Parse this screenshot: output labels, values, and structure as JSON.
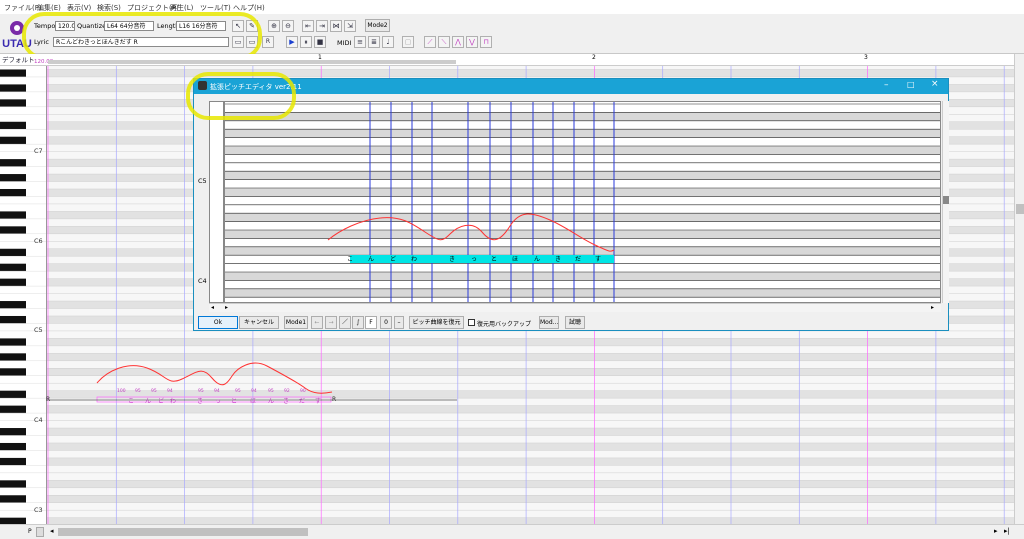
{
  "menu": [
    "ファイル(F)",
    "編集(E)",
    "表示(V)",
    "検索(S)",
    "プロジェクト(P)",
    "再生(L)",
    "ツール(T)",
    "ヘルプ(H)"
  ],
  "logo": "UTAU",
  "toolbar": {
    "tempo_label": "Tempo",
    "tempo_value": "120.0",
    "quantize_label": "Quantize",
    "quantize_value": "L64 64分音符",
    "length_label": "Length",
    "length_value": "L16 16分音符",
    "lyric_label": "Lyric",
    "lyric_value": "Rこんどわきっとほんきだす R",
    "mode2_label": "Mode2",
    "midi_label": "MIDI",
    "r_label": "R"
  },
  "ruler": {
    "track_label": "デフォルト",
    "tempo_marker": "120.00",
    "measures": [
      "1",
      "2",
      "3"
    ]
  },
  "piano": {
    "octaves": [
      "C7",
      "C6",
      "C5",
      "C4",
      "C3"
    ]
  },
  "roll": {
    "rest_label": "R",
    "notes": [
      "こ",
      "ん",
      "ど",
      "わ",
      "き",
      "っ",
      "と",
      "ほ",
      "ん",
      "き",
      "だ",
      "す"
    ],
    "velocities": [
      "100",
      "95",
      "95",
      "94",
      "95",
      "94",
      "95",
      "94",
      "95",
      "92",
      "90"
    ]
  },
  "dialog": {
    "title": "拡張ピッチエディタ ver2.11",
    "octaves": [
      "C5",
      "C4"
    ],
    "notes": [
      "こ",
      "ん",
      "ど",
      "わ",
      "き",
      "っ",
      "と",
      "ほ",
      "ん",
      "き",
      "だ",
      "す"
    ],
    "buttons": {
      "ok": "Ok",
      "cancel": "キャンセル",
      "mode1": "Mode1",
      "f": "F",
      "zero": "0",
      "restore": "ピッチ曲線を復元",
      "backup": "復元用バックアップ",
      "mod": "Mod...",
      "trial": "試聴"
    }
  },
  "scroll": {
    "p_label": "P"
  },
  "colors": {
    "highlight": "#ffff00",
    "pitch": "#ff3333",
    "note_cyan": "#00e5e5",
    "barline": "#ff66ff",
    "dlg_title": "#1aa3d6"
  }
}
